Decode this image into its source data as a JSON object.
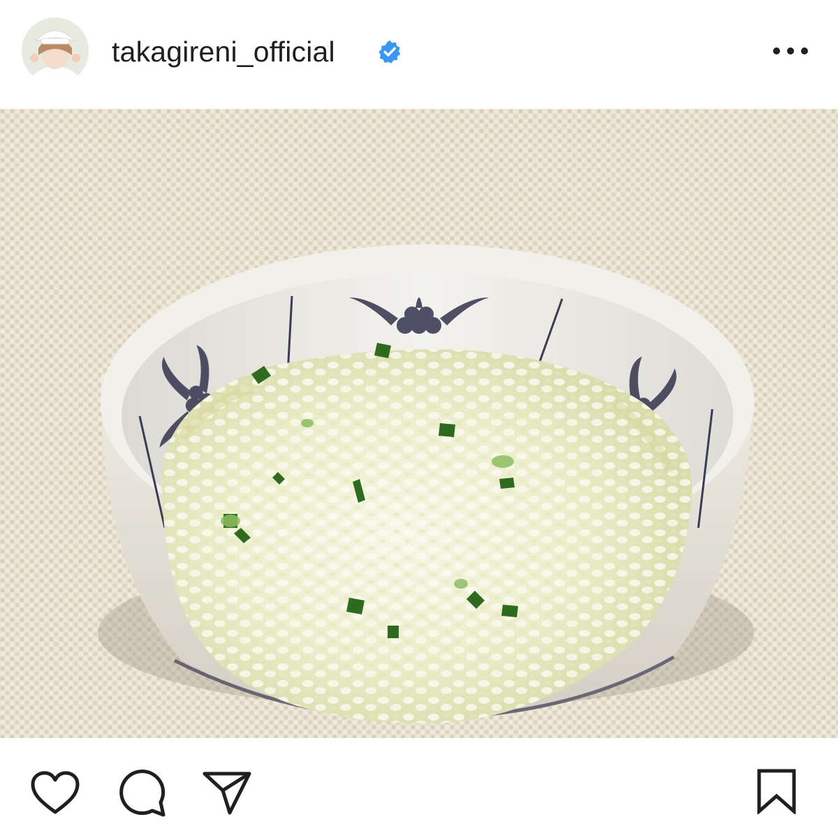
{
  "post": {
    "username": "takagireni_official",
    "verified": true,
    "avatar_icon": "profile-avatar",
    "more_icon": "more-options-icon"
  },
  "photo": {
    "subject_icon": "rice-porridge-bowl"
  },
  "actions": {
    "like_icon": "heart-icon",
    "comment_icon": "comment-icon",
    "share_icon": "send-icon",
    "save_icon": "bookmark-icon"
  },
  "colors": {
    "verified_badge": "#3897f0",
    "text": "#1f1f1f",
    "placemat": "#e9e1d2",
    "porridge": "#eeeed0",
    "bowl_pattern": "#3c3b55"
  }
}
